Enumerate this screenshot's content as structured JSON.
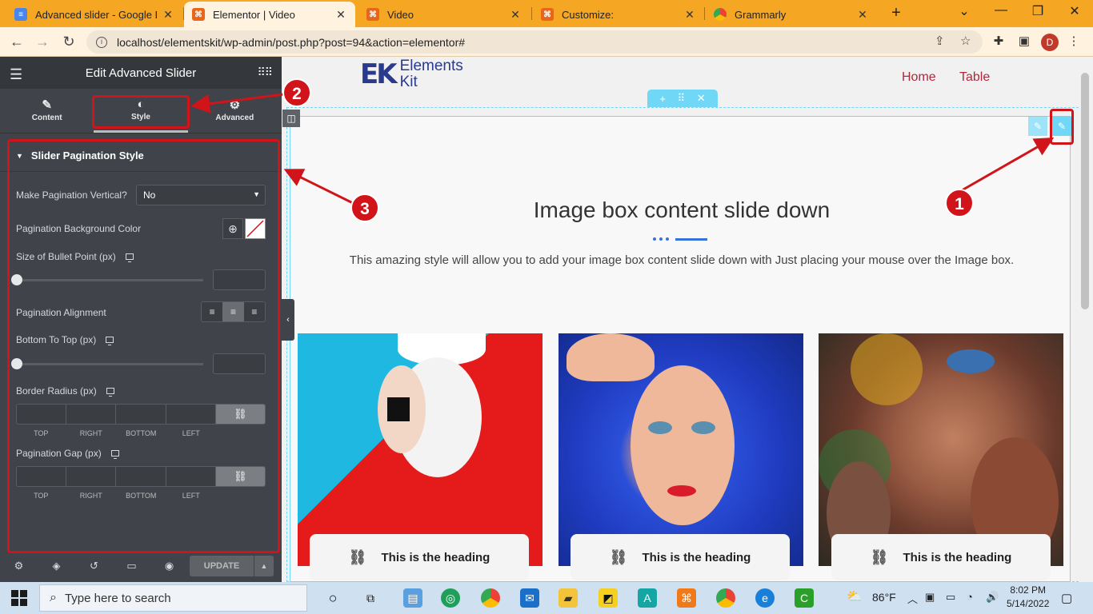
{
  "browser": {
    "tabs": [
      {
        "title": "Advanced slider - Google Do",
        "icon": "google-docs-icon",
        "color": "#4a86e8"
      },
      {
        "title": "Elementor | Video",
        "icon": "xampp-icon",
        "color": "#e8661a"
      },
      {
        "title": "Video",
        "icon": "xampp-icon",
        "color": "#e8661a"
      },
      {
        "title": "Customize:",
        "icon": "xampp-icon",
        "color": "#e8661a"
      },
      {
        "title": "Grammarly",
        "icon": "chrome-icon",
        "color": "#2aa35a"
      }
    ],
    "new_tab": "+",
    "url": "localhost/elementskit/wp-admin/post.php?post=94&action=elementor#",
    "profile_initial": "D"
  },
  "panel": {
    "title": "Edit Advanced Slider",
    "tabs": [
      {
        "label": "Content",
        "icon": "pencil-icon"
      },
      {
        "label": "Style",
        "icon": "contrast-icon"
      },
      {
        "label": "Advanced",
        "icon": "gear-icon"
      }
    ],
    "section_title": "Slider Pagination Style",
    "controls": {
      "vertical_label": "Make Pagination Vertical?",
      "vertical_value": "No",
      "bg_color_label": "Pagination Background Color",
      "bullet_size_label": "Size of Bullet Point (px)",
      "alignment_label": "Pagination Alignment",
      "bottom_top_label": "Bottom To Top (px)",
      "border_radius_label": "Border Radius (px)",
      "gap_label": "Pagination Gap (px)",
      "dim_labels": [
        "TOP",
        "RIGHT",
        "BOTTOM",
        "LEFT"
      ]
    },
    "update_label": "UPDATE"
  },
  "site": {
    "logo_line1": "Elements",
    "logo_line2": "Kit",
    "nav": [
      "Home",
      "Table"
    ],
    "heading": "Image box content slide down",
    "description": "This amazing style will allow you to add your image box content slide down with Just placing your mouse over the Image box.",
    "cards": [
      {
        "heading": "This is the heading"
      },
      {
        "heading": "This is the heading"
      },
      {
        "heading": "This is the heading"
      }
    ]
  },
  "annotations": [
    "1",
    "2",
    "3"
  ],
  "taskbar": {
    "search_placeholder": "Type here to search",
    "temperature": "86°F",
    "time": "8:02 PM",
    "date": "5/14/2022"
  }
}
